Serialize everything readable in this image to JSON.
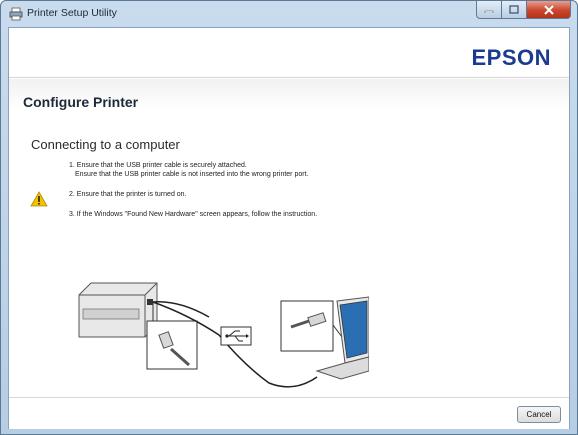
{
  "window": {
    "title": "Printer Setup Utility"
  },
  "header": {
    "brand": "EPSON"
  },
  "main": {
    "page_title": "Configure Printer",
    "section_title": "Connecting to a computer",
    "steps": [
      "1. Ensure that the USB printer cable is securely attached.",
      "Ensure that the USB printer cable is not inserted into the wrong printer port.",
      "2. Ensure that the printer is turned on.",
      "3. If the Windows \"Found New Hardware\" screen appears, follow the instruction."
    ]
  },
  "footer": {
    "cancel_label": "Cancel"
  },
  "colors": {
    "brand": "#1a3b8f",
    "warning": "#f2c200",
    "close_button": "#c9462c"
  },
  "icons": {
    "title": "printer-icon",
    "warning": "warning-triangle-icon",
    "usb": "usb-symbol-icon"
  }
}
